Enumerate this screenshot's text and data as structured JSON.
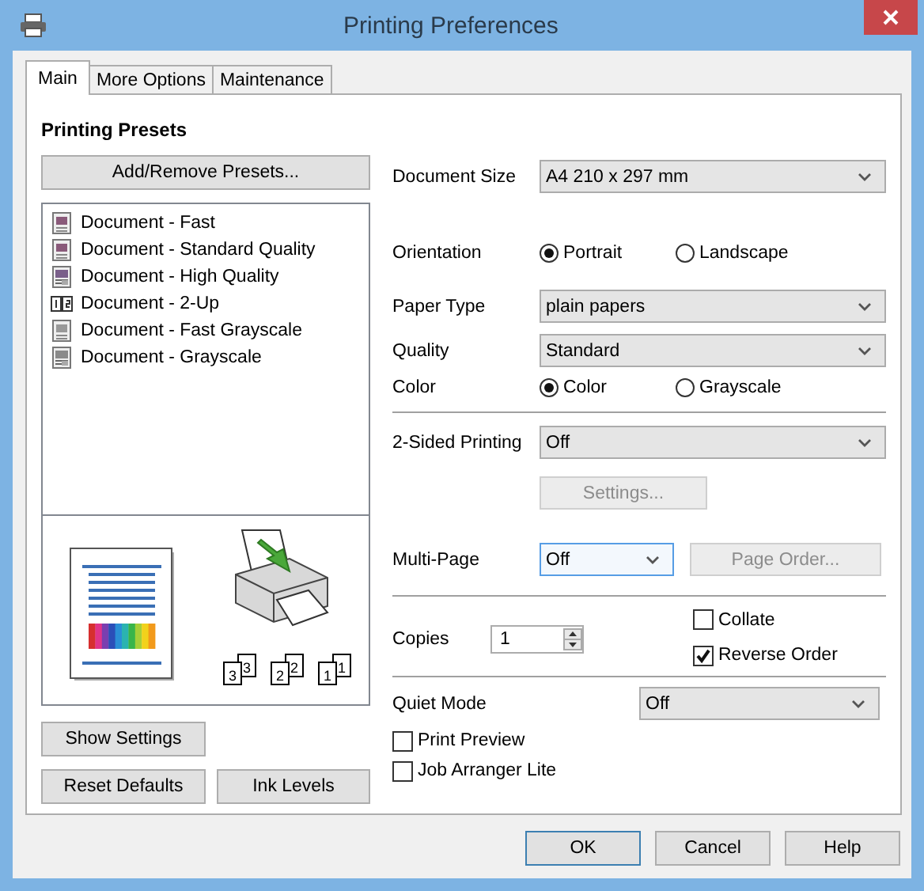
{
  "window": {
    "title": "Printing Preferences"
  },
  "tabs": [
    {
      "label": "Main",
      "selected": true
    },
    {
      "label": "More Options",
      "selected": false
    },
    {
      "label": "Maintenance",
      "selected": false
    }
  ],
  "presets": {
    "heading": "Printing Presets",
    "button": "Add/Remove Presets...",
    "items": [
      {
        "label": "Document - Fast",
        "kind": "color"
      },
      {
        "label": "Document - Standard Quality",
        "kind": "color"
      },
      {
        "label": "Document - High Quality",
        "kind": "photo"
      },
      {
        "label": "Document - 2-Up",
        "kind": "two-up"
      },
      {
        "label": "Document - Fast Grayscale",
        "kind": "gray"
      },
      {
        "label": "Document - Grayscale",
        "kind": "gray-photo"
      }
    ]
  },
  "preview": {
    "collate_sets": [
      {
        "back": "3",
        "front": "3"
      },
      {
        "back": "2",
        "front": "2"
      },
      {
        "back": "1",
        "front": "1"
      }
    ]
  },
  "left_buttons": [
    "Show Settings",
    "Reset Defaults",
    "Ink Levels"
  ],
  "document_size": {
    "label": "Document Size",
    "value": "A4 210 x 297 mm"
  },
  "orientation": {
    "label": "Orientation",
    "options": [
      {
        "label": "Portrait",
        "selected": true
      },
      {
        "label": "Landscape",
        "selected": false
      }
    ]
  },
  "paper_type": {
    "label": "Paper Type",
    "value": "plain papers"
  },
  "quality": {
    "label": "Quality",
    "value": "Standard"
  },
  "color": {
    "label": "Color",
    "options": [
      {
        "label": "Color",
        "selected": true
      },
      {
        "label": "Grayscale",
        "selected": false
      }
    ]
  },
  "two_sided": {
    "label": "2-Sided Printing",
    "value": "Off",
    "button": {
      "label": "Settings...",
      "disabled": true
    }
  },
  "multi_page": {
    "label": "Multi-Page",
    "value": "Off",
    "focused": true,
    "button": {
      "label": "Page Order...",
      "disabled": true
    }
  },
  "copies": {
    "label": "Copies",
    "value": "1"
  },
  "collate": {
    "label": "Collate",
    "checked": false
  },
  "reverse_order": {
    "label": "Reverse Order",
    "checked": true
  },
  "quiet_mode": {
    "label": "Quiet Mode",
    "value": "Off"
  },
  "print_preview": {
    "label": "Print Preview",
    "checked": false
  },
  "job_arranger": {
    "label": "Job Arranger Lite",
    "checked": false
  },
  "dialog_buttons": [
    {
      "label": "OK",
      "default": true
    },
    {
      "label": "Cancel",
      "default": false
    },
    {
      "label": "Help",
      "default": false
    }
  ]
}
